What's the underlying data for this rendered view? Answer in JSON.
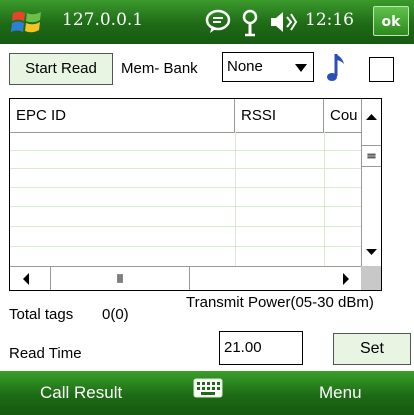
{
  "titlebar": {
    "title": "127.0.0.1",
    "clock": "12:16",
    "ok_label": "ok"
  },
  "toolbar": {
    "start_read_label": "Start Read",
    "membank_label": "Mem- Bank",
    "membank_value": "None"
  },
  "grid": {
    "columns": [
      "EPC ID",
      "RSSI",
      "Cou"
    ],
    "rows": []
  },
  "status": {
    "total_tags_label": "Total tags",
    "total_tags_value": "0(0)",
    "transmit_power_label": "Transmit Power(05-30 dBm)",
    "read_time_label": "Read Time",
    "power_value": "21.00",
    "set_label": "Set"
  },
  "softkeys": {
    "left": "Call Result",
    "right": "Menu"
  },
  "icons": {
    "start": "windows-flag-icon",
    "messages": "message-bubble-icon",
    "signal": "signal-antenna-icon",
    "volume": "speaker-icon",
    "sound": "music-note-icon",
    "keyboard": "keyboard-icon"
  },
  "colors": {
    "bar_green": "#1e6a16",
    "button_fill": "#e8f5e3",
    "note_blue": "#2b4fb8"
  }
}
